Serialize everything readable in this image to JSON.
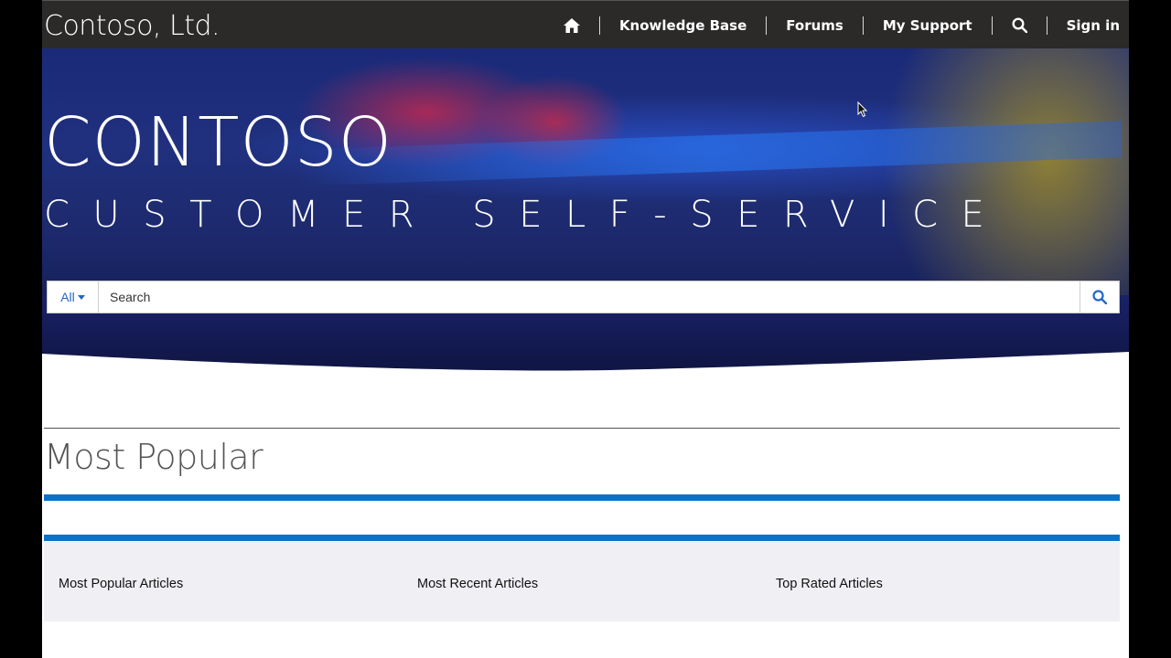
{
  "site": {
    "brand": "Contoso, Ltd."
  },
  "nav": {
    "home_icon": "home-icon",
    "items": [
      {
        "label": "Knowledge Base"
      },
      {
        "label": "Forums"
      },
      {
        "label": "My Support"
      }
    ],
    "search_icon": "search-icon",
    "sign_in": "Sign in"
  },
  "hero": {
    "title": "CONTOSO",
    "subtitle": "CUSTOMER SELF-SERVICE"
  },
  "search": {
    "filter_label": "All",
    "placeholder": "Search",
    "value": "",
    "button_icon": "search-icon"
  },
  "main": {
    "section_title": "Most Popular",
    "columns": [
      {
        "label": "Most Popular Articles"
      },
      {
        "label": "Most Recent Articles"
      },
      {
        "label": "Top Rated Articles"
      }
    ]
  },
  "colors": {
    "nav_bg": "#2b2a29",
    "accent": "#0b72c8",
    "link": "#2266c8",
    "panel_bg": "#f0f0f4"
  }
}
